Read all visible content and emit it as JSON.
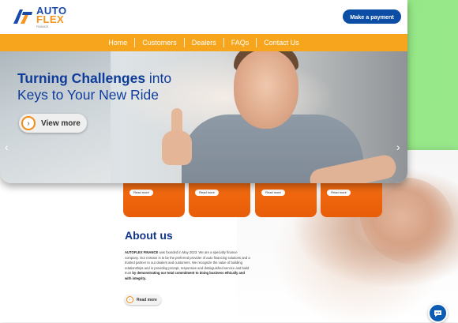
{
  "header": {
    "logo_top": "AUTO",
    "logo_bottom": "FLEX",
    "logo_tagline": "FINANCE",
    "pay_button": "Make a payment"
  },
  "nav": {
    "items": [
      "Home",
      "Customers",
      "Dealers",
      "FAQs",
      "Contact Us"
    ]
  },
  "hero": {
    "title_bold": "Turning Challenges",
    "title_rest": "into",
    "title_line2": "Keys to Your New Ride",
    "cta": "View more",
    "arrow_left": "‹",
    "arrow_right": "›"
  },
  "cards": {
    "read_more": "Read more"
  },
  "about": {
    "title": "About us",
    "body_bold": "AUTOFLEX FINANCE",
    "body_text": "was founded in May 2023. We are a specialty finance company. Our mission is to be the preferred provider of auto financing solutions and a trusted partner to our dealers and customers. We recognize the value of building relationships and in providing prompt, responsive and distinguished service and build trust",
    "body_bold2": "by demonstrating our total commitment to doing business ethically and with integrity.",
    "read_more": "Read more"
  },
  "colors": {
    "brand_blue": "#0c4ea6",
    "brand_orange": "#f6a51c",
    "card_orange": "#ff7a1a",
    "green_bg": "#8ee47e"
  },
  "icons": [
    "logo-mark-icon",
    "chevron-right-icon",
    "chat-icon",
    "arrow-left-icon",
    "arrow-right-icon"
  ]
}
